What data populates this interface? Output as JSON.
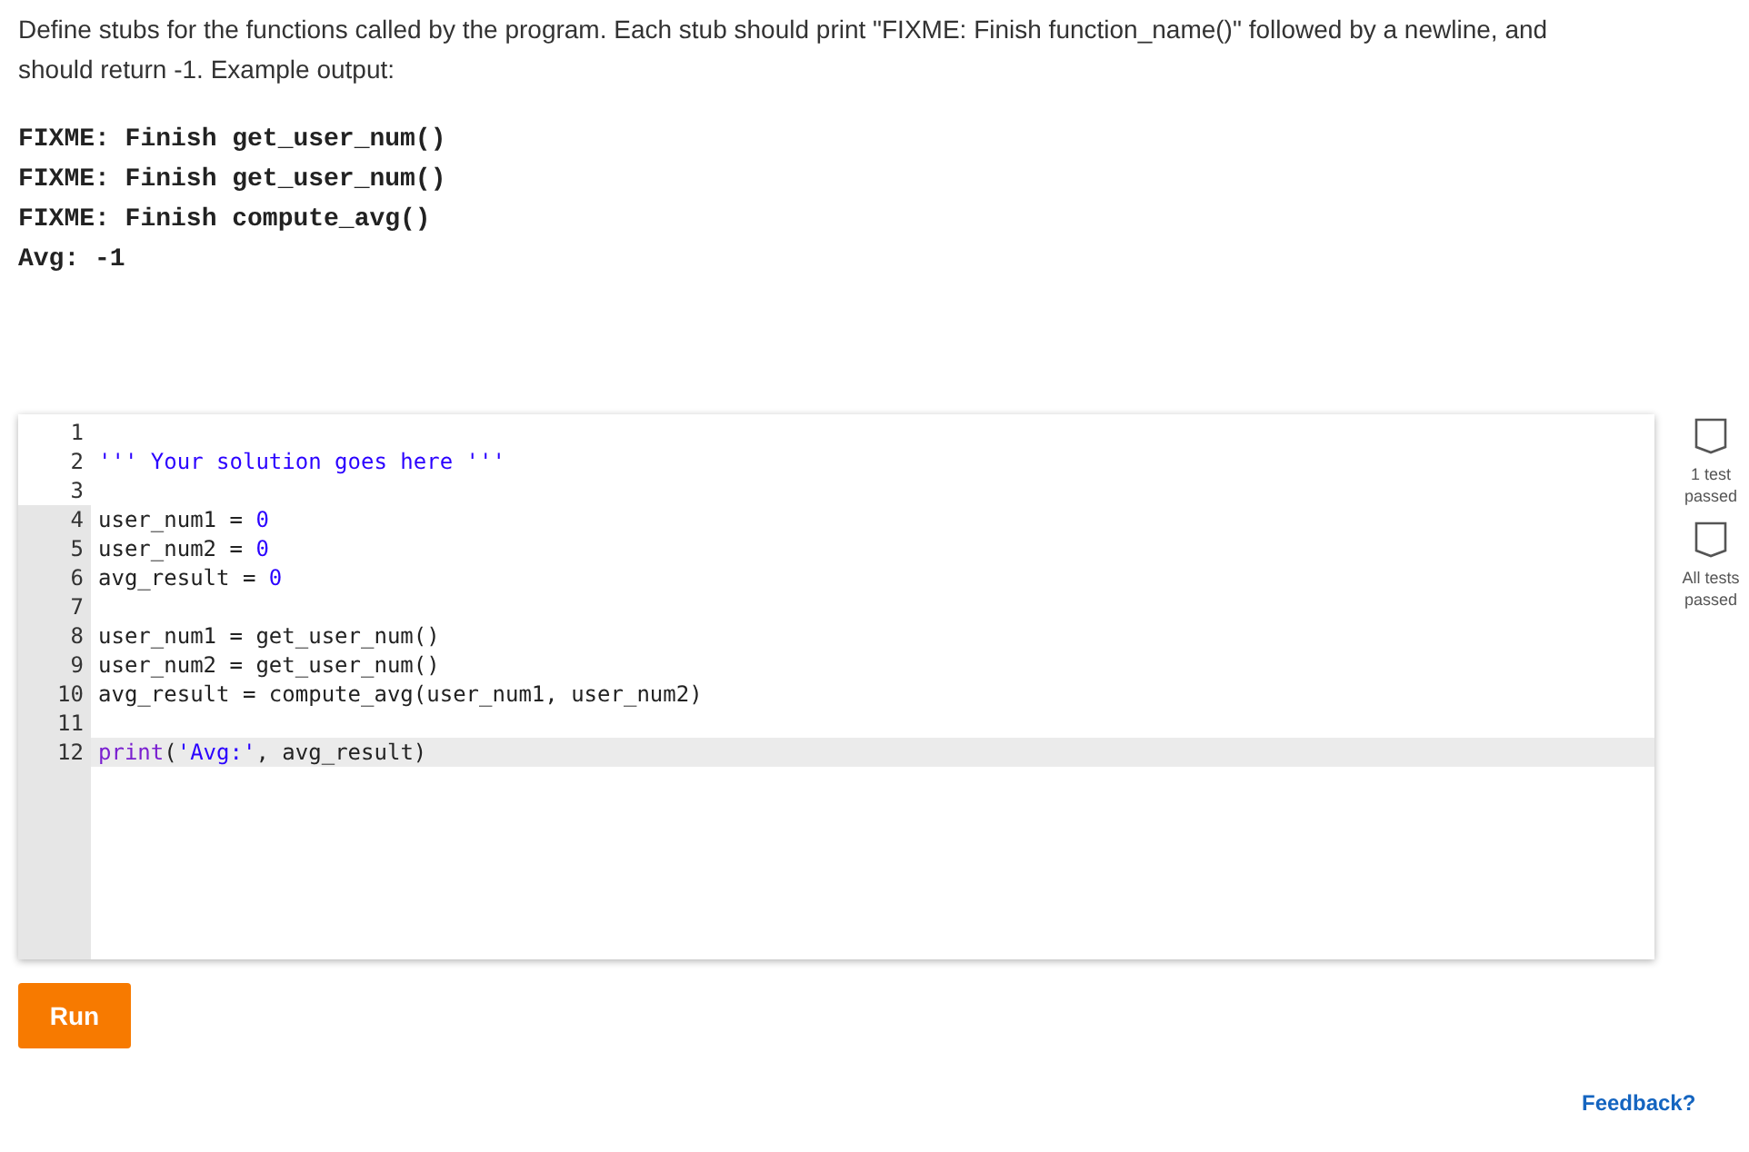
{
  "instructions": "Define stubs for the functions called by the program. Each stub should print \"FIXME: Finish function_name()\" followed by a newline, and should return -1. Example output:",
  "example_output": [
    "FIXME: Finish get_user_num()",
    "FIXME: Finish get_user_num()",
    "FIXME: Finish compute_avg()",
    "Avg: -1"
  ],
  "editor": {
    "lines": [
      {
        "number": "1",
        "readonly": true,
        "active": false
      },
      {
        "number": "2",
        "readonly": true,
        "active": false,
        "tokens": [
          {
            "kind": "string",
            "text": "''' Your solution goes here '''"
          }
        ]
      },
      {
        "number": "3",
        "readonly": true,
        "active": false
      },
      {
        "number": "4",
        "readonly": false,
        "active": false,
        "tokens": [
          {
            "kind": "plain",
            "text": "user_num1 = "
          },
          {
            "kind": "number",
            "text": "0"
          }
        ]
      },
      {
        "number": "5",
        "readonly": false,
        "active": false,
        "tokens": [
          {
            "kind": "plain",
            "text": "user_num2 = "
          },
          {
            "kind": "number",
            "text": "0"
          }
        ]
      },
      {
        "number": "6",
        "readonly": false,
        "active": false,
        "tokens": [
          {
            "kind": "plain",
            "text": "avg_result = "
          },
          {
            "kind": "number",
            "text": "0"
          }
        ]
      },
      {
        "number": "7",
        "readonly": false,
        "active": false
      },
      {
        "number": "8",
        "readonly": false,
        "active": false,
        "tokens": [
          {
            "kind": "plain",
            "text": "user_num1 = get_user_num()"
          }
        ]
      },
      {
        "number": "9",
        "readonly": false,
        "active": false,
        "tokens": [
          {
            "kind": "plain",
            "text": "user_num2 = get_user_num()"
          }
        ]
      },
      {
        "number": "10",
        "readonly": false,
        "active": false,
        "tokens": [
          {
            "kind": "plain",
            "text": "avg_result = compute_avg(user_num1, user_num2)"
          }
        ]
      },
      {
        "number": "11",
        "readonly": false,
        "active": false
      },
      {
        "number": "12",
        "readonly": false,
        "active": true,
        "tokens": [
          {
            "kind": "keyword",
            "text": "print"
          },
          {
            "kind": "plain",
            "text": "("
          },
          {
            "kind": "string",
            "text": "'Avg:'"
          },
          {
            "kind": "plain",
            "text": ", avg_result)"
          }
        ]
      }
    ]
  },
  "tests": [
    {
      "label": "1 test passed",
      "passed": false
    },
    {
      "label": "All tests passed",
      "passed": false
    }
  ],
  "run_button": "Run",
  "feedback_link": "Feedback?"
}
